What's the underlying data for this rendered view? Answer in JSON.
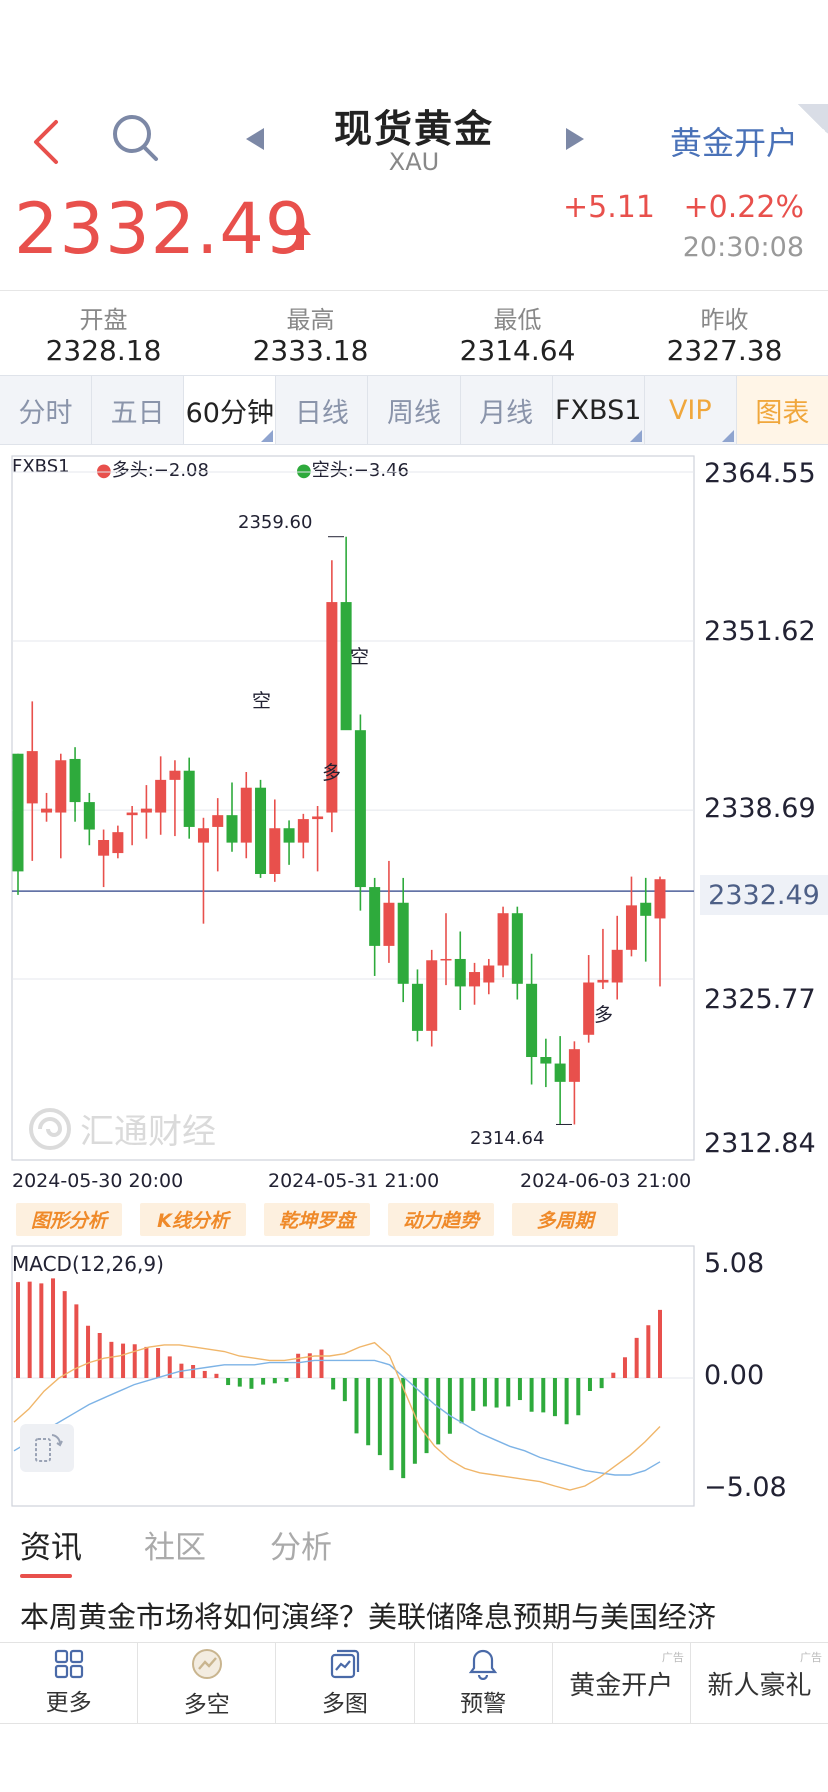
{
  "header": {
    "title": "现货黄金",
    "subtitle": "XAU",
    "open_account": "黄金开户"
  },
  "quote": {
    "price": "2332.49",
    "change": "+5.11",
    "change_pct": "+0.22%",
    "time": "20:30:08",
    "up_color": "#e8504c",
    "down_color": "#2eaa3c"
  },
  "stats": [
    {
      "label": "开盘",
      "value": "2328.18"
    },
    {
      "label": "最高",
      "value": "2333.18"
    },
    {
      "label": "最低",
      "value": "2314.64"
    },
    {
      "label": "昨收",
      "value": "2327.38"
    }
  ],
  "tabs": [
    "分时",
    "五日",
    "60分钟",
    "日线",
    "周线",
    "月线",
    "FXBS1",
    "VIP",
    "图表"
  ],
  "chart": {
    "indicator": "FXBS1",
    "long_label": "多头:−2.08",
    "short_label": "空头:−3.46",
    "y_labels": [
      "2364.55",
      "2351.62",
      "2338.69",
      "2332.49",
      "2325.77",
      "2312.84"
    ],
    "high_label": "2359.60",
    "low_label": "2314.64",
    "dates": [
      "2024-05-30 20:00",
      "2024-05-31 21:00",
      "2024-06-03 21:00"
    ],
    "watermark": "汇通财经",
    "markers": [
      "空",
      "多",
      "空",
      "多"
    ]
  },
  "chart_data": {
    "type": "candlestick",
    "ylim": [
      2312.84,
      2364.55
    ],
    "last_price": 2332.49,
    "candles": [
      {
        "o": 2343.0,
        "h": 2343.0,
        "l": 2332.2,
        "c": 2334.0
      },
      {
        "o": 2339.2,
        "h": 2347.0,
        "l": 2334.8,
        "c": 2343.2
      },
      {
        "o": 2338.5,
        "h": 2340.0,
        "l": 2337.8,
        "c": 2338.8
      },
      {
        "o": 2338.5,
        "h": 2343.0,
        "l": 2335.0,
        "c": 2342.5
      },
      {
        "o": 2342.6,
        "h": 2343.5,
        "l": 2337.8,
        "c": 2339.3
      },
      {
        "o": 2339.3,
        "h": 2340.0,
        "l": 2336.0,
        "c": 2337.2
      },
      {
        "o": 2335.2,
        "h": 2337.2,
        "l": 2332.8,
        "c": 2336.4
      },
      {
        "o": 2335.4,
        "h": 2337.5,
        "l": 2335.0,
        "c": 2337.0
      },
      {
        "o": 2338.3,
        "h": 2339.0,
        "l": 2336.0,
        "c": 2338.5
      },
      {
        "o": 2338.5,
        "h": 2340.6,
        "l": 2336.5,
        "c": 2338.8
      },
      {
        "o": 2338.5,
        "h": 2342.8,
        "l": 2336.8,
        "c": 2341.0
      },
      {
        "o": 2341.0,
        "h": 2342.5,
        "l": 2336.7,
        "c": 2341.7
      },
      {
        "o": 2341.7,
        "h": 2342.7,
        "l": 2336.5,
        "c": 2337.4
      },
      {
        "o": 2336.2,
        "h": 2338.1,
        "l": 2330.0,
        "c": 2337.3
      },
      {
        "o": 2337.4,
        "h": 2339.6,
        "l": 2334.0,
        "c": 2338.3
      },
      {
        "o": 2338.3,
        "h": 2340.8,
        "l": 2335.5,
        "c": 2336.2
      },
      {
        "o": 2336.2,
        "h": 2341.6,
        "l": 2335.0,
        "c": 2340.4
      },
      {
        "o": 2340.4,
        "h": 2341.0,
        "l": 2333.5,
        "c": 2333.8
      },
      {
        "o": 2333.8,
        "h": 2339.5,
        "l": 2333.2,
        "c": 2337.3
      },
      {
        "o": 2337.3,
        "h": 2337.9,
        "l": 2334.5,
        "c": 2336.2
      },
      {
        "o": 2336.2,
        "h": 2338.4,
        "l": 2335.0,
        "c": 2338.0
      },
      {
        "o": 2338.0,
        "h": 2339.0,
        "l": 2334.0,
        "c": 2338.2
      },
      {
        "o": 2338.5,
        "h": 2357.8,
        "l": 2337.0,
        "c": 2354.6
      },
      {
        "o": 2354.6,
        "h": 2359.6,
        "l": 2345.7,
        "c": 2344.8
      },
      {
        "o": 2344.8,
        "h": 2346.0,
        "l": 2331.0,
        "c": 2332.8
      },
      {
        "o": 2332.8,
        "h": 2333.5,
        "l": 2326.0,
        "c": 2328.3
      },
      {
        "o": 2328.3,
        "h": 2334.8,
        "l": 2327.0,
        "c": 2331.6
      },
      {
        "o": 2331.6,
        "h": 2333.5,
        "l": 2324.0,
        "c": 2325.4
      },
      {
        "o": 2325.4,
        "h": 2326.5,
        "l": 2321.0,
        "c": 2321.8
      },
      {
        "o": 2321.8,
        "h": 2328.0,
        "l": 2320.6,
        "c": 2327.2
      },
      {
        "o": 2327.2,
        "h": 2330.8,
        "l": 2325.3,
        "c": 2327.3
      },
      {
        "o": 2327.3,
        "h": 2329.4,
        "l": 2323.4,
        "c": 2325.2
      },
      {
        "o": 2325.2,
        "h": 2327.0,
        "l": 2323.8,
        "c": 2326.3
      },
      {
        "o": 2325.5,
        "h": 2327.3,
        "l": 2324.6,
        "c": 2326.8
      },
      {
        "o": 2326.8,
        "h": 2331.3,
        "l": 2325.9,
        "c": 2330.8
      },
      {
        "o": 2330.8,
        "h": 2331.3,
        "l": 2324.2,
        "c": 2325.4
      },
      {
        "o": 2325.4,
        "h": 2327.7,
        "l": 2317.7,
        "c": 2319.8
      },
      {
        "o": 2319.8,
        "h": 2321.2,
        "l": 2317.5,
        "c": 2319.3
      },
      {
        "o": 2319.3,
        "h": 2321.4,
        "l": 2314.64,
        "c": 2317.9
      },
      {
        "o": 2317.9,
        "h": 2321.0,
        "l": 2314.64,
        "c": 2320.4
      },
      {
        "o": 2321.5,
        "h": 2327.6,
        "l": 2320.9,
        "c": 2325.5
      },
      {
        "o": 2325.5,
        "h": 2329.6,
        "l": 2325.0,
        "c": 2325.7
      },
      {
        "o": 2325.5,
        "h": 2330.6,
        "l": 2324.2,
        "c": 2328.0
      },
      {
        "o": 2328.0,
        "h": 2333.6,
        "l": 2327.5,
        "c": 2331.4
      },
      {
        "o": 2331.6,
        "h": 2333.5,
        "l": 2327.1,
        "c": 2330.6
      },
      {
        "o": 2330.4,
        "h": 2333.6,
        "l": 2325.2,
        "c": 2333.4
      }
    ]
  },
  "macd": {
    "title": "MACD(12,26,9)",
    "y_labels": [
      "5.08",
      "0.00",
      "−5.08"
    ],
    "ylim": [
      -5.08,
      5.08
    ],
    "hist": [
      4.35,
      4.37,
      4.29,
      4.52,
      3.94,
      3.34,
      2.37,
      2.04,
      1.64,
      1.56,
      1.53,
      1.41,
      1.36,
      0.98,
      0.65,
      0.59,
      0.32,
      0.19,
      -0.32,
      -0.39,
      -0.49,
      -0.3,
      -0.24,
      -0.17,
      1.1,
      1.12,
      1.29,
      -0.52,
      -1.05,
      -2.51,
      -3.05,
      -3.5,
      -4.18,
      -4.54,
      -3.89,
      -3.41,
      -3.01,
      -2.53,
      -2.05,
      -1.49,
      -1.29,
      -1.34,
      -1.29,
      -1.0,
      -1.53,
      -1.56,
      -1.73,
      -2.1,
      -1.69,
      -0.59,
      -0.46,
      0.24,
      0.94,
      1.82,
      2.39,
      3.09
    ],
    "dif": [
      -2.0,
      -1.4,
      -0.6,
      0.0,
      0.4,
      0.7,
      0.9,
      1.0,
      1.2,
      1.4,
      1.5,
      1.5,
      1.4,
      1.3,
      1.2,
      1.0,
      0.9,
      0.8,
      0.8,
      0.9,
      1.0,
      1.0,
      1.1,
      1.4,
      1.6,
      1.0,
      -0.6,
      -2.2,
      -3.1,
      -3.7,
      -4.1,
      -4.3,
      -4.4,
      -4.5,
      -4.6,
      -4.7,
      -4.9,
      -5.08,
      -4.9,
      -4.5,
      -4.0,
      -3.5,
      -2.9,
      -2.2
    ],
    "dea": [
      -3.3,
      -2.9,
      -2.4,
      -2.0,
      -1.6,
      -1.2,
      -0.9,
      -0.6,
      -0.3,
      -0.1,
      0.1,
      0.3,
      0.4,
      0.5,
      0.6,
      0.6,
      0.6,
      0.7,
      0.7,
      0.7,
      0.8,
      0.8,
      0.8,
      0.8,
      0.8,
      0.6,
      0.0,
      -0.6,
      -1.2,
      -1.7,
      -2.1,
      -2.5,
      -2.8,
      -3.1,
      -3.3,
      -3.6,
      -3.8,
      -4.0,
      -4.2,
      -4.3,
      -4.4,
      -4.4,
      -4.2,
      -3.8
    ]
  },
  "analysis_buttons": [
    "图形分析",
    "K线分析",
    "乾坤罗盘",
    "动力趋势",
    "多周期"
  ],
  "news_tabs": [
    "资讯",
    "社区",
    "分析"
  ],
  "headline": "本周黄金市场将如何演绎？美联储降息预期与美国经济",
  "bottom_bar": [
    {
      "label": "更多",
      "icon": "grid-icon"
    },
    {
      "label": "多空",
      "icon": "trend-circle-icon"
    },
    {
      "label": "多图",
      "icon": "multi-chart-icon"
    },
    {
      "label": "预警",
      "icon": "bell-icon"
    },
    {
      "label": "黄金开户",
      "ad": "广告"
    },
    {
      "label": "新人豪礼",
      "ad": "广告"
    }
  ]
}
